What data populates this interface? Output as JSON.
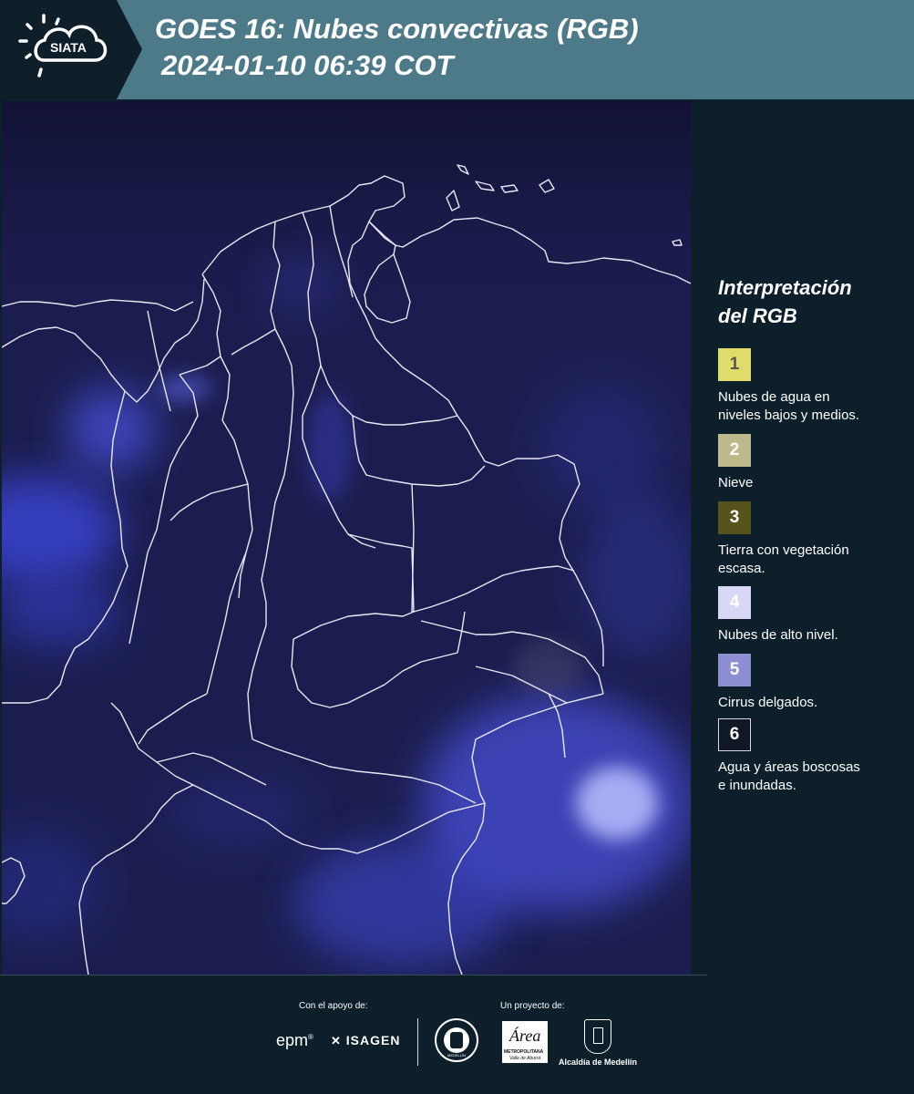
{
  "header": {
    "logo_text": "SIATA",
    "title_line1": "GOES 16: Nubes convectivas (RGB)",
    "title_line2": "2024-01-10 06:39 COT",
    "background_color": "#4d7a89",
    "logo_block_color": "#0e1f2a"
  },
  "map": {
    "region": "Colombia",
    "background_color": "#1b1c4e"
  },
  "legend": {
    "title_line1": "Interpretación",
    "title_line2": "del RGB",
    "items": [
      {
        "number": "1",
        "label_line1": "Nubes de agua en",
        "label_line2": "niveles bajos y medios.",
        "color": "#e0dc6a",
        "text_color": "#555555"
      },
      {
        "number": "2",
        "label_line1": "Nieve",
        "label_line2": "",
        "color": "#bdb98a",
        "text_color": "#ffffff"
      },
      {
        "number": "3",
        "label_line1": "Tierra con vegetación",
        "label_line2": "escasa.",
        "color": "#56531d",
        "text_color": "#ffffff"
      },
      {
        "number": "4",
        "label_line1": "Nubes de alto nivel.",
        "label_line2": "",
        "color": "#d8d8f6",
        "text_color": "#ffffff"
      },
      {
        "number": "5",
        "label_line1": "Cirrus delgados.",
        "label_line2": "",
        "color": "#8e8ed2",
        "text_color": "#ffffff"
      },
      {
        "number": "6",
        "label_line1": "Agua y áreas boscosas",
        "label_line2": "e inundadas.",
        "color": "#101826",
        "text_color": "#ffffff"
      }
    ]
  },
  "footer": {
    "support_label": "Con el apoyo de:",
    "project_label": "Un proyecto de:",
    "sponsor1": "epm",
    "sponsor2": "ISAGEN",
    "project_logo2_text": "Área",
    "project_logo2_sub1": "METROPOLITANA",
    "project_logo2_sub2": "Valle de Aburrá",
    "project_logo3": "Alcaldía de Medellín",
    "project_logo1_text": "MEDELLÍN"
  }
}
